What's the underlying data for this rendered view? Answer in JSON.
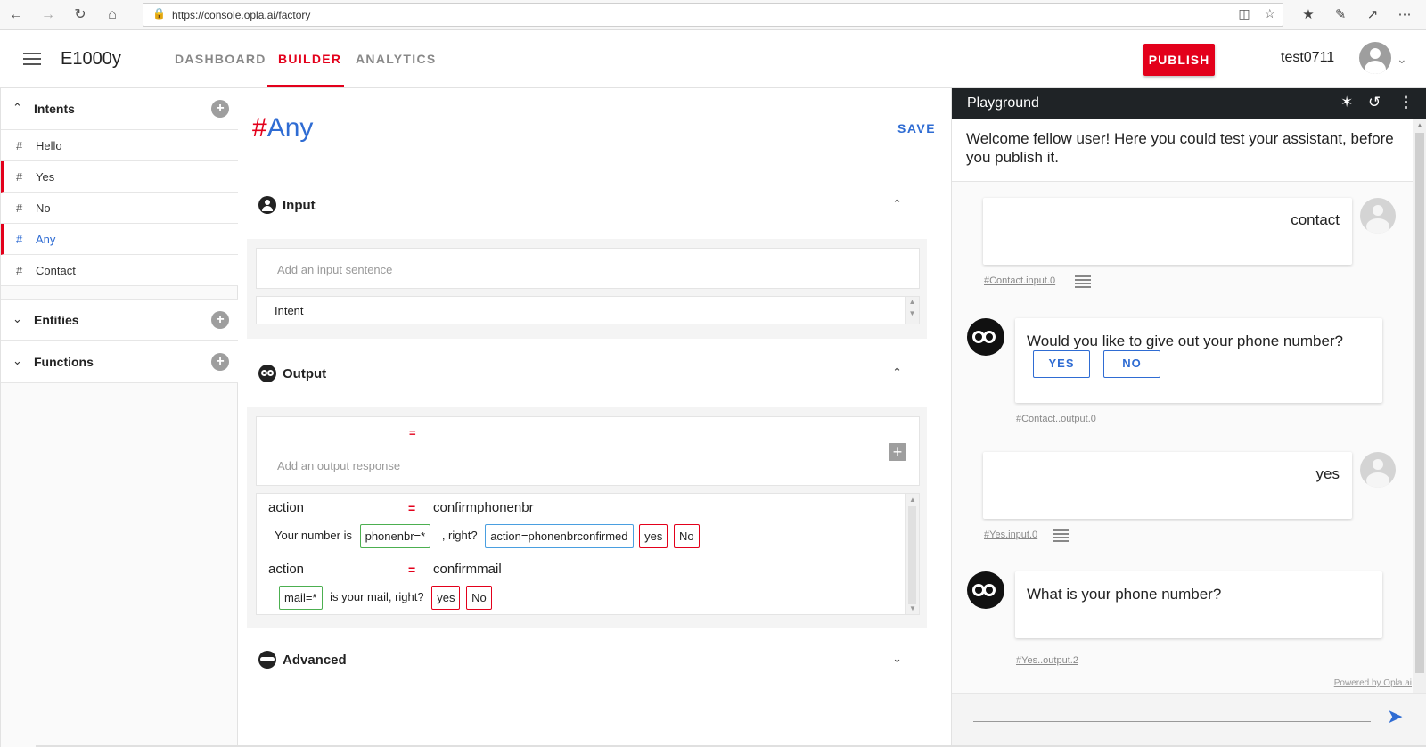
{
  "browser": {
    "url": "https://console.opla.ai/factory"
  },
  "header": {
    "app_title": "E1000y",
    "tabs": [
      {
        "label": "DASHBOARD"
      },
      {
        "label": "BUILDER"
      },
      {
        "label": "ANALYTICS"
      }
    ],
    "active_tab": "BUILDER",
    "publish_label": "PUBLISH",
    "username": "test0711"
  },
  "sidebar": {
    "intents_title": "Intents",
    "intents": [
      {
        "hash": "#",
        "label": "Hello"
      },
      {
        "hash": "#",
        "label": "Yes"
      },
      {
        "hash": "#",
        "label": "No"
      },
      {
        "hash": "#",
        "label": "Any"
      },
      {
        "hash": "#",
        "label": "Contact"
      }
    ],
    "active_intent": "Any",
    "entities_title": "Entities",
    "functions_title": "Functions"
  },
  "editor": {
    "title_hash": "#",
    "title_name": "Any",
    "save_label": "SAVE",
    "input": {
      "title": "Input",
      "placeholder": "Add an input sentence",
      "intent_label": "Intent"
    },
    "output": {
      "title": "Output",
      "eq": "=",
      "placeholder": "Add an output response",
      "responses": [
        {
          "key": "action",
          "eq": "=",
          "value": "confirmphonenbr",
          "parts": {
            "t1": "Your number is",
            "c1": "phonenbr=*",
            "t2": ", right?",
            "c2": "action=phonenbrconfirmed",
            "c3": "yes",
            "c4": "No"
          }
        },
        {
          "key": "action",
          "eq": "=",
          "value": "confirmmail",
          "parts": {
            "c1": "mail=*",
            "t1": "is your mail, right?",
            "c2": "yes",
            "c3": "No"
          }
        }
      ]
    },
    "advanced": {
      "title": "Advanced"
    }
  },
  "playground": {
    "title": "Playground",
    "welcome": "Welcome fellow user! Here you could test your assistant, before you publish it.",
    "messages": [
      {
        "from": "user",
        "text": "contact",
        "trace": "#Contact.input.0"
      },
      {
        "from": "bot",
        "text": "Would you like to give out your phone number?",
        "buttons": [
          "YES",
          "NO"
        ],
        "trace": "#Contact..output.0"
      },
      {
        "from": "user",
        "text": "yes",
        "trace": "#Yes.input.0"
      },
      {
        "from": "bot",
        "text": "What is your phone number?",
        "trace": "#Yes..output.2"
      }
    ],
    "powered_by": "Powered by Opla.ai"
  },
  "colors": {
    "accent_red": "#e3001b",
    "accent_blue": "#2f6cd3",
    "playground_header": "#1f2326"
  },
  "icons": {
    "menu": "hamburger-icon",
    "bug": "bug-icon",
    "reset": "refresh-icon",
    "more": "more-vert-icon",
    "send": "send-icon"
  }
}
